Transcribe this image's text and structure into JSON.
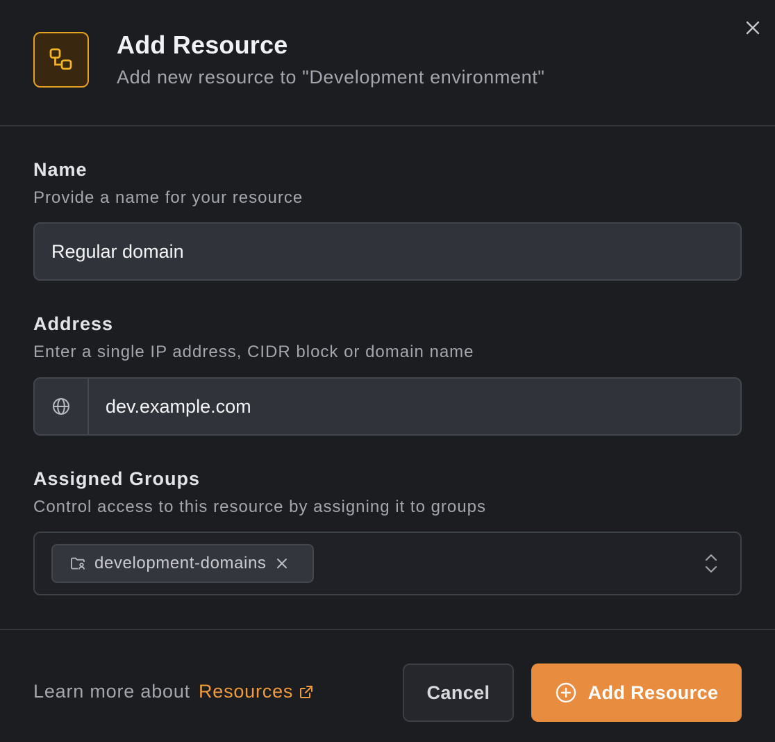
{
  "header": {
    "title": "Add Resource",
    "subtitle": "Add new resource to \"Development environment\"",
    "icon": "resource-nodes-icon",
    "close_icon": "close-icon"
  },
  "form": {
    "name": {
      "label": "Name",
      "help": "Provide a name for your resource",
      "value": "Regular domain"
    },
    "address": {
      "label": "Address",
      "help": "Enter a single IP address, CIDR block or domain name",
      "prefix_icon": "globe-icon",
      "value": "dev.example.com"
    },
    "groups": {
      "label": "Assigned Groups",
      "help": "Control access to this resource by assigning it to groups",
      "chips": [
        {
          "label": "development-domains",
          "icon": "folder-user-icon"
        }
      ],
      "toggle_icon": "chevron-up-down-icon"
    }
  },
  "footer": {
    "learn_prefix": "Learn more about",
    "learn_link": "Resources",
    "cancel_label": "Cancel",
    "submit_label": "Add Resource",
    "submit_icon": "plus-circle-icon"
  },
  "colors": {
    "background": "#1c1d21",
    "accent": "#e88c40",
    "link": "#f09a3e",
    "icon_border": "#e4a320"
  }
}
